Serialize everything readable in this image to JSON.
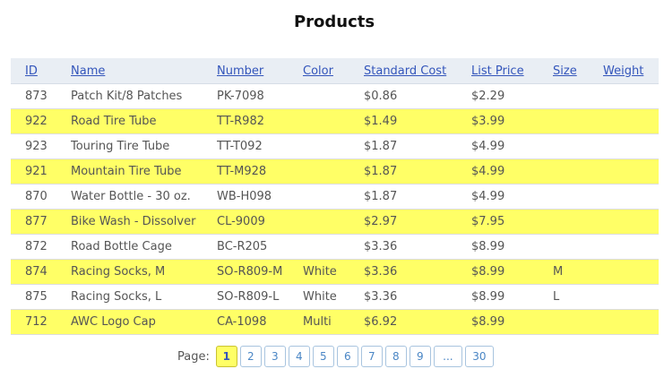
{
  "title": "Products",
  "colors": {
    "header_bg": "#e9eef4",
    "alt_row_bg": "#ffff66",
    "link": "#3355bb"
  },
  "columns": [
    "ID",
    "Name",
    "Number",
    "Color",
    "Standard Cost",
    "List Price",
    "Size",
    "Weight"
  ],
  "rows": [
    [
      "873",
      "Patch Kit/8 Patches",
      "PK-7098",
      "",
      "$0.86",
      "$2.29",
      "",
      ""
    ],
    [
      "922",
      "Road Tire Tube",
      "TT-R982",
      "",
      "$1.49",
      "$3.99",
      "",
      ""
    ],
    [
      "923",
      "Touring Tire Tube",
      "TT-T092",
      "",
      "$1.87",
      "$4.99",
      "",
      ""
    ],
    [
      "921",
      "Mountain Tire Tube",
      "TT-M928",
      "",
      "$1.87",
      "$4.99",
      "",
      ""
    ],
    [
      "870",
      "Water Bottle - 30 oz.",
      "WB-H098",
      "",
      "$1.87",
      "$4.99",
      "",
      ""
    ],
    [
      "877",
      "Bike Wash - Dissolver",
      "CL-9009",
      "",
      "$2.97",
      "$7.95",
      "",
      ""
    ],
    [
      "872",
      "Road Bottle Cage",
      "BC-R205",
      "",
      "$3.36",
      "$8.99",
      "",
      ""
    ],
    [
      "874",
      "Racing Socks, M",
      "SO-R809-M",
      "White",
      "$3.36",
      "$8.99",
      "M",
      ""
    ],
    [
      "875",
      "Racing Socks, L",
      "SO-R809-L",
      "White",
      "$3.36",
      "$8.99",
      "L",
      ""
    ],
    [
      "712",
      "AWC Logo Cap",
      "CA-1098",
      "Multi",
      "$6.92",
      "$8.99",
      "",
      ""
    ]
  ],
  "pager": {
    "label": "Page:",
    "pages": [
      "1",
      "2",
      "3",
      "4",
      "5",
      "6",
      "7",
      "8",
      "9",
      "...",
      "30"
    ],
    "current": "1"
  }
}
